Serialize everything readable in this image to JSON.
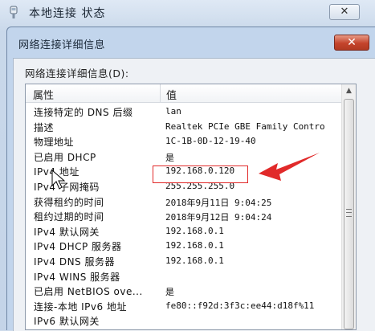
{
  "background_window": {
    "title": "本地连接 状态",
    "close_label": "✕"
  },
  "dialog": {
    "title": "网络连接详细信息",
    "close_label": "✕",
    "group_label": "网络连接详细信息(D):",
    "columns": {
      "property": "属性",
      "value": "值"
    },
    "rows": [
      {
        "property": "连接特定的 DNS 后缀",
        "value": "lan"
      },
      {
        "property": "描述",
        "value": "Realtek PCIe GBE Family Contro"
      },
      {
        "property": "物理地址",
        "value": "1C-1B-0D-12-19-40"
      },
      {
        "property": "已启用 DHCP",
        "value": "是"
      },
      {
        "property": "IPv4 地址",
        "value": "192.168.0.120"
      },
      {
        "property": "IPv4 子网掩码",
        "value": "255.255.255.0"
      },
      {
        "property": "获得租约的时间",
        "value": "2018年9月11日 9:04:25"
      },
      {
        "property": "租约过期的时间",
        "value": "2018年9月12日 9:04:24"
      },
      {
        "property": "IPv4 默认网关",
        "value": "192.168.0.1"
      },
      {
        "property": "IPv4 DHCP 服务器",
        "value": "192.168.0.1"
      },
      {
        "property": "IPv4 DNS 服务器",
        "value": "192.168.0.1"
      },
      {
        "property": "IPv4 WINS 服务器",
        "value": ""
      },
      {
        "property": "已启用 NetBIOS ove...",
        "value": "是"
      },
      {
        "property": "连接-本地 IPv6 地址",
        "value": "fe80::f92d:3f3c:ee44:d18f%11"
      },
      {
        "property": "IPv6 默认网关",
        "value": ""
      }
    ]
  },
  "colors": {
    "annotation": "#e12a2a",
    "close_button": "#c4442c"
  }
}
